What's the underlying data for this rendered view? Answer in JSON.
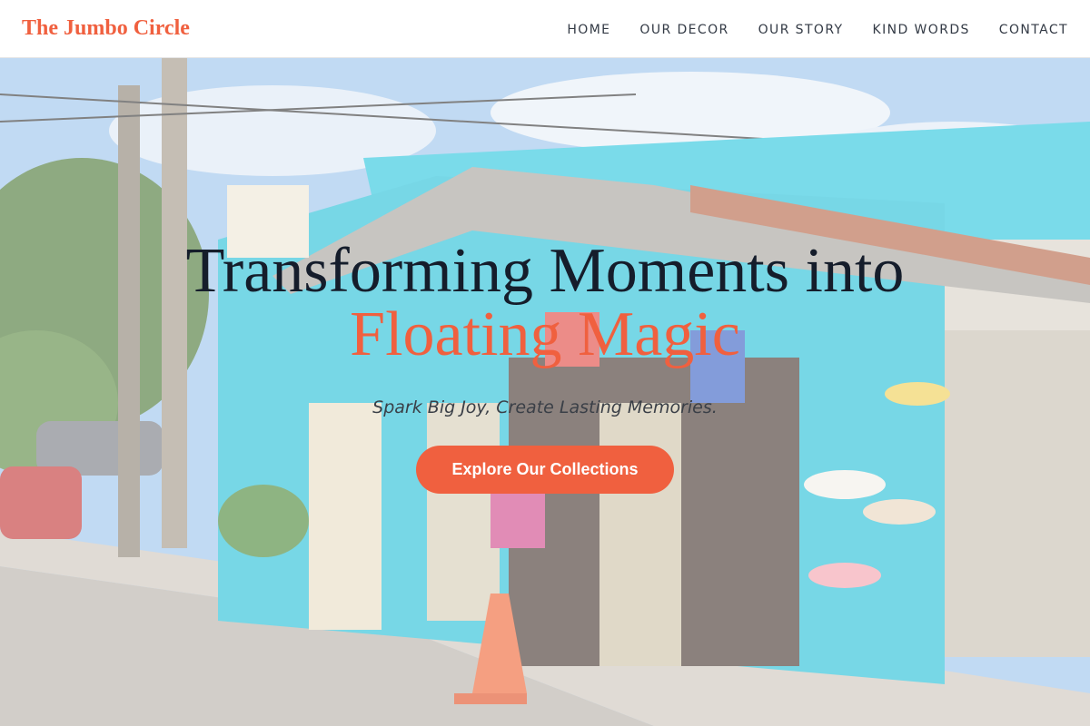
{
  "brand": {
    "name": "The Jumbo Circle"
  },
  "nav": {
    "items": [
      {
        "label": "HOME"
      },
      {
        "label": "OUR DECOR"
      },
      {
        "label": "OUR STORY"
      },
      {
        "label": "KIND WORDS"
      },
      {
        "label": "CONTACT"
      }
    ]
  },
  "hero": {
    "headline_line1": "Transforming Moments into",
    "headline_line2": "Floating Magic",
    "tagline": "Spark Big Joy, Create Lasting Memories.",
    "cta_label": "Explore Our Collections",
    "background_icon": "storefront-photo"
  },
  "colors": {
    "accent": "#f0603f",
    "headline": "#151d2b",
    "nav_text": "#333a45"
  }
}
